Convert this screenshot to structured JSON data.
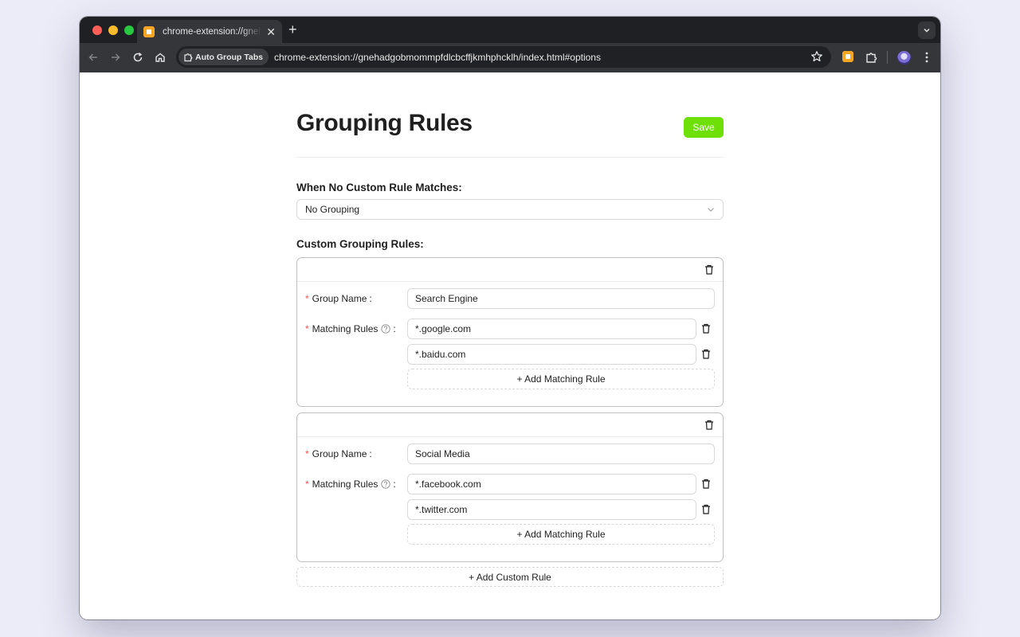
{
  "browser": {
    "tab_title": "chrome-extension://gnehadgobmommpfdlcbcffjkmhphcklh/index.html#options",
    "chip_label": "Auto Group Tabs",
    "url": "chrome-extension://gnehadgobmommpfdlcbcffjkmhphcklh/index.html#options",
    "new_tab_glyph": "+",
    "close_glyph": "✕"
  },
  "page": {
    "title": "Grouping Rules",
    "save_label": "Save",
    "default_label": "When No Custom Rule Matches:",
    "default_value": "No Grouping",
    "custom_label": "Custom Grouping Rules:",
    "group_name_label": "Group Name",
    "matching_rules_label": "Matching Rules",
    "required_mark": "*",
    "colon": ":",
    "add_matching_rule_label": "+ Add Matching Rule",
    "add_custom_rule_label": "+ Add Custom Rule"
  },
  "groups": [
    {
      "name": "Search Engine",
      "rules": [
        "*.google.com",
        "*.baidu.com"
      ]
    },
    {
      "name": "Social Media",
      "rules": [
        "*.facebook.com",
        "*.twitter.com"
      ]
    }
  ],
  "colors": {
    "accent": "#6ee007",
    "required": "#ff4d4f"
  }
}
